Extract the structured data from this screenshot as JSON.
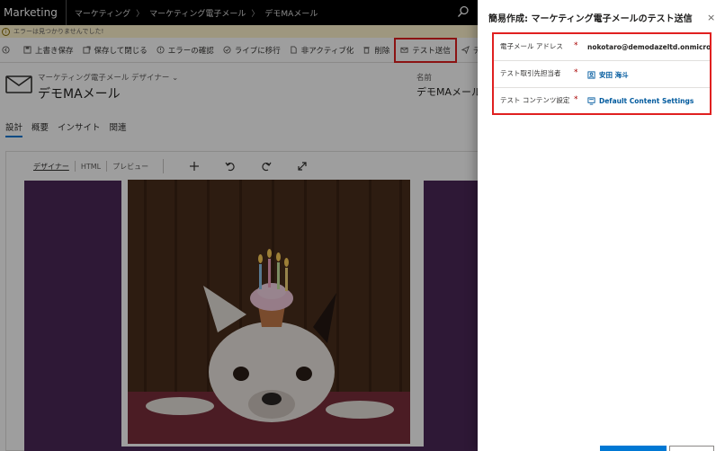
{
  "app": {
    "brand": "Marketing",
    "breadcrumbs": [
      "マーケティング",
      "マーケティング電子メール",
      "デモMAメール"
    ],
    "breadcrumb_separator": "〉"
  },
  "error_bar": {
    "message": "エラーは見つかりませんでした!"
  },
  "commands": {
    "save": "上書き保存",
    "save_close": "保存して閉じる",
    "check_errors": "エラーの確認",
    "go_live": "ライブに移行",
    "deactivate": "非アクティブ化",
    "delete": "削除",
    "test_send": "テスト送信",
    "overflow": "デ"
  },
  "header": {
    "form_type": "マーケティング電子メール デザイナー",
    "record_title": "デモMAメール",
    "name_label": "名前",
    "name_value": "デモMAメール"
  },
  "tabs": [
    "設計",
    "概要",
    "インサイト",
    "関連"
  ],
  "designer": {
    "tabs": [
      "デザイナー",
      "HTML",
      "プレビュー"
    ],
    "tools": [
      "add-icon",
      "undo-icon",
      "redo-icon",
      "expand-icon"
    ]
  },
  "panel": {
    "title": "簡易作成: マーケティング電子メールのテスト送信",
    "close": "×",
    "fields": [
      {
        "label": "電子メール アドレス",
        "required": "*",
        "value": "nokotaro@demodazeltd.onmicrosoft.com"
      },
      {
        "label": "テスト取引先担当者",
        "required": "*",
        "value": "安田 海斗"
      },
      {
        "label": "テスト コンテンツ設定",
        "required": "*",
        "value": "Default Content Settings"
      }
    ]
  },
  "colors": {
    "accent": "#0078d4",
    "highlight": "#e02020",
    "canvas": "#4b2857",
    "topbar": "#000000"
  }
}
